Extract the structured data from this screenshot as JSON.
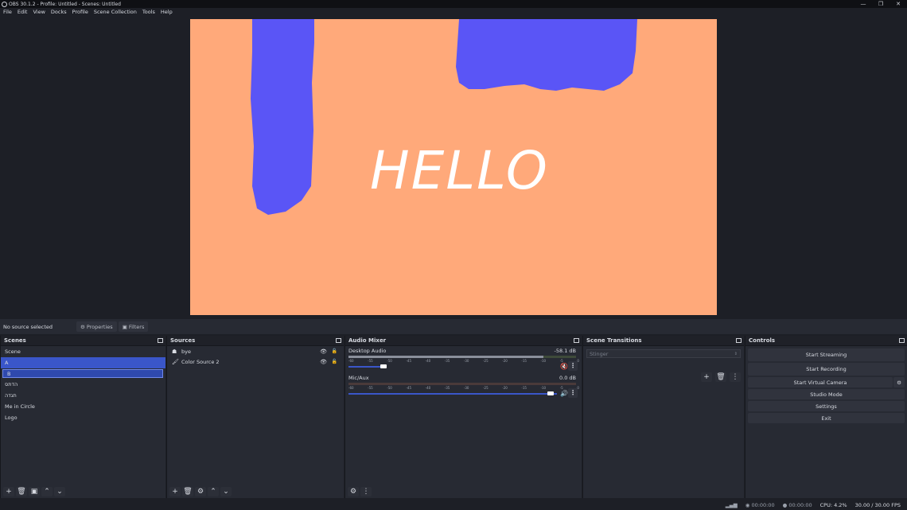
{
  "window": {
    "title": "OBS 30.1.2 - Profile: Untitled - Scenes: Untitled",
    "controls": [
      "—",
      "❐",
      "✕"
    ]
  },
  "menu": [
    "File",
    "Edit",
    "View",
    "Docks",
    "Profile",
    "Scene Collection",
    "Tools",
    "Help"
  ],
  "preview": {
    "text": "HELLO",
    "colors": {
      "background": "#ffa97a",
      "paint": "#5a55f6",
      "text": "#ffffff"
    }
  },
  "context": {
    "selection": "No source selected",
    "properties_label": "Properties",
    "filters_label": "Filters"
  },
  "scenes": {
    "title": "Scenes",
    "items": [
      {
        "label": "Scene"
      },
      {
        "label": "A"
      },
      {
        "label": "B"
      },
      {
        "label": "הדתס"
      },
      {
        "label": "תגדה"
      },
      {
        "label": "Me in Circle"
      },
      {
        "label": "Logo"
      }
    ]
  },
  "sources": {
    "title": "Sources",
    "items": [
      {
        "label": "bye"
      },
      {
        "label": "Color Source 2"
      }
    ]
  },
  "mixer": {
    "title": "Audio Mixer",
    "ticks": [
      "-60",
      "-55",
      "-50",
      "-45",
      "-40",
      "-35",
      "-30",
      "-25",
      "-20",
      "-15",
      "-10",
      "-5",
      "0"
    ],
    "channels": [
      {
        "name": "Desktop Audio",
        "db": "-58.1 dB",
        "volume": 0.17,
        "muted": true
      },
      {
        "name": "Mic/Aux",
        "db": "0.0 dB",
        "volume": 1.0,
        "muted": false
      }
    ]
  },
  "transitions": {
    "title": "Scene Transitions",
    "selected": "Stinger"
  },
  "controls": {
    "title": "Controls",
    "start_streaming": "Start Streaming",
    "start_recording": "Start Recording",
    "start_virtual_camera": "Start Virtual Camera",
    "studio_mode": "Studio Mode",
    "settings": "Settings",
    "exit": "Exit"
  },
  "status": {
    "stream_time": "00:00:00",
    "rec_time": "00:00:00",
    "cpu": "CPU: 4.2%",
    "fps": "30.00 / 30.00 FPS"
  }
}
